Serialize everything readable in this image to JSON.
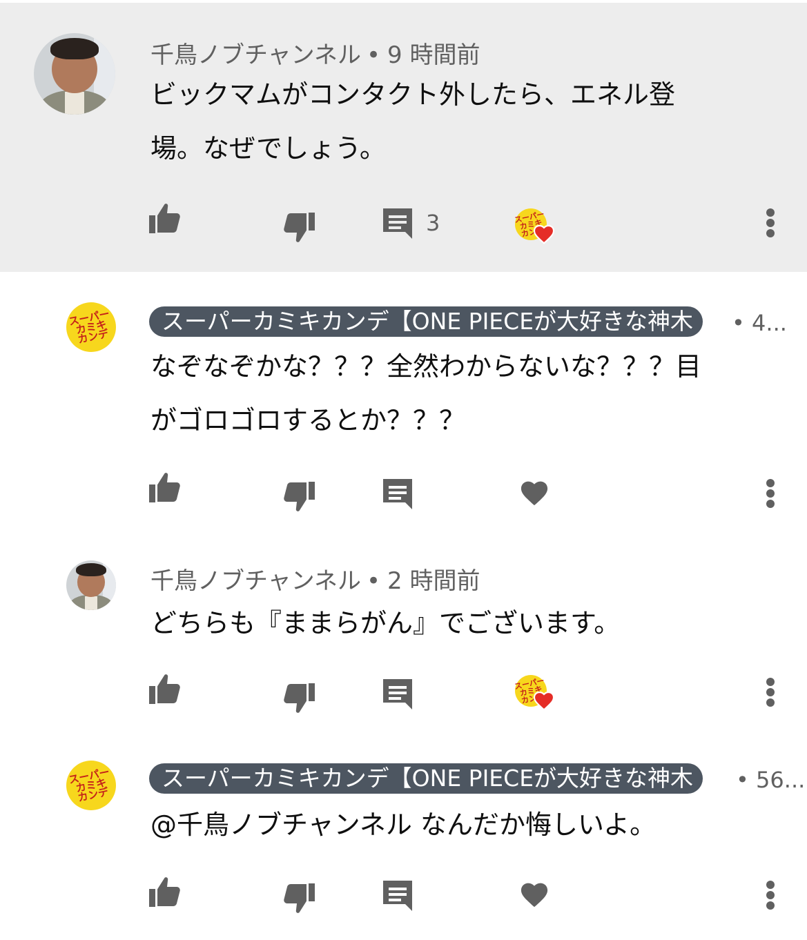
{
  "comments": [
    {
      "author": "千鳥ノブチャンネル",
      "time": "9 時間前",
      "text_lines": [
        "ビックマムがコンタクト外したら、エネル登",
        "場。なぜでしょう。"
      ],
      "reply_count": "3",
      "hearted": true
    },
    {
      "author": "スーパーカミキカンデ【ONE PIECEが大好きな神木",
      "time": "4...",
      "text_lines": [
        "なぞなぞかな？？？全然わからないな？？？目",
        "がゴロゴロするとか？？？"
      ],
      "hearted": false
    },
    {
      "author": "千鳥ノブチャンネル",
      "time": "2 時間前",
      "text_lines": [
        "どちらも『ままらがん』でございます。"
      ],
      "hearted": true
    },
    {
      "author": "スーパーカミキカンデ【ONE PIECEが大好きな神木",
      "time": "56...",
      "text_lines": [
        "@千鳥ノブチャンネル なんだか悔しいよ。"
      ],
      "hearted": false
    }
  ],
  "logo": {
    "line1": "スーパー",
    "line2": "カミキ",
    "line3": "カンデ"
  },
  "separator": "•",
  "colors": {
    "highlight_bg": "#ededed",
    "badge_bg": "#4d5661",
    "icon_gray": "#606060",
    "logo_yellow": "#f7d71d",
    "logo_red": "#c4211a",
    "heart_red": "#e52d27"
  },
  "icons": [
    "thumb-up-icon",
    "thumb-down-icon",
    "reply-icon",
    "heart-icon",
    "more-vert-icon"
  ]
}
